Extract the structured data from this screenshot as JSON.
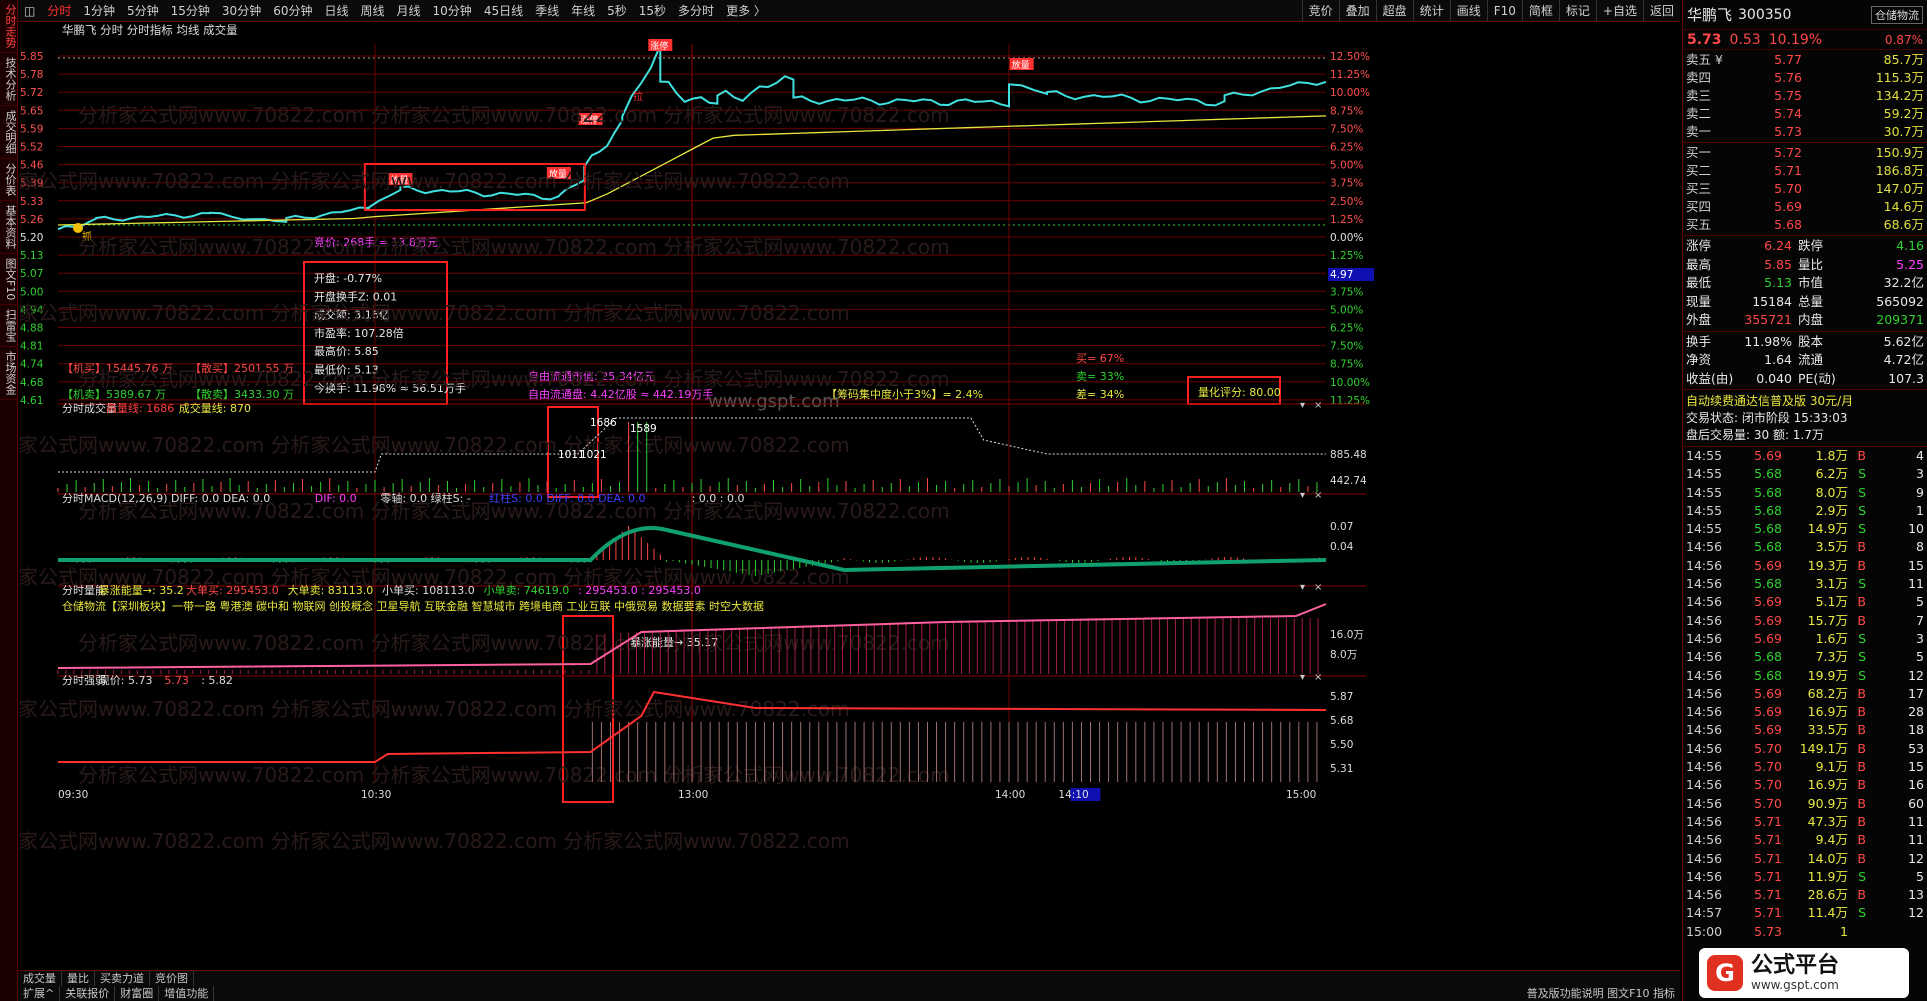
{
  "left_tabs": [
    "分时走势",
    "技术分析",
    "成交明细",
    "分价表",
    "基本资料",
    "图文F10",
    "扫雷宝",
    "市场资金"
  ],
  "top_tabs": [
    "分时",
    "1分钟",
    "5分钟",
    "15分钟",
    "30分钟",
    "60分钟",
    "日线",
    "周线",
    "月线",
    "10分钟",
    "45日线",
    "季线",
    "年线",
    "5秒",
    "15秒",
    "多分时",
    "更多 〉"
  ],
  "top_right": [
    "竞价",
    "叠加",
    "超盘",
    "统计",
    "画线",
    "F10",
    "简框",
    "标记",
    "+自选",
    "返回"
  ],
  "chart_title": {
    "stock": "华鹏飞",
    "items": [
      "分时",
      "分时指标",
      "均线",
      "成交量"
    ]
  },
  "price_axis": [
    "5.85",
    "5.78",
    "5.72",
    "5.65",
    "5.59",
    "5.52",
    "5.46",
    "5.39",
    "5.33",
    "5.26",
    "5.20",
    "5.13",
    "5.07",
    "5.00",
    "4.94",
    "4.88",
    "4.81",
    "4.74",
    "4.68",
    "4.61"
  ],
  "pct_axis": [
    "12.50%",
    "11.25%",
    "10.00%",
    "8.75%",
    "7.50%",
    "6.25%",
    "5.00%",
    "3.75%",
    "2.50%",
    "1.25%",
    "0.00%",
    "1.25%",
    "2.50%",
    "3.75%",
    "5.00%",
    "6.25%",
    "7.50%",
    "8.75%",
    "10.00%",
    "11.25%"
  ],
  "mark_497": "4.97",
  "badges": {
    "zhangting": "涨停",
    "huitiao": "拉",
    "zhuaqi": "抓",
    "fangliang": "放量"
  },
  "info_box": [
    "开盘: -0.77%",
    "开盘换手Z: 0.01",
    "成交额: 3.16亿",
    "市盈率: 107.28倍",
    "最高价: 5.85",
    "最低价: 5.13",
    "今换手: 11.98% ≈ 56.51万手"
  ],
  "auction_text": "竞价: 268手 = 13.8万元",
  "jimai1": "【机买】15445.76 万",
  "sanmai1": "【散买】2501.55 万",
  "jimai2": "【机卖】5389.67 万",
  "sanmai2": "【散卖】3433.30 万",
  "float_value": "自由流通市值: 25.34亿元",
  "float_shares": "自由流通盘: 4.42亿股 ≈ 442.19万手",
  "jizhongdu": "【筹码集中度小于3%】= 2.4%",
  "maibi": [
    "买= 67%",
    "卖= 33%",
    "差= 34%"
  ],
  "score": "量化评分: 80.00",
  "watermark": "分析家公式网www.70822.com",
  "center_watermark": "www.gspt.com",
  "vol_panel": {
    "title": "分时成交量",
    "l1": "高量线: 1686",
    "l2": "成交量线: 870",
    "axis": [
      "885.48",
      "442.74"
    ],
    "labels": [
      "1686",
      "1589",
      "1011",
      "1021"
    ]
  },
  "macd_panel": {
    "title": "分时MACD(12,26,9) DIFF: 0.0 DEA: 0.0",
    "extra": "DIF: 0.0",
    "extra2": "零轴: 0.0 绿柱S: -",
    "extra3": "红柱S: 0.0 DIFF: 0.0 DEA: 0.0",
    "extra4": ": 0.0 : 0.0",
    "axis": [
      "0.07",
      "0.04"
    ]
  },
  "energy_panel": {
    "title": "分时量能",
    "l1": "暴涨能量→: 35.2",
    "l2": "大单买: 295453.0",
    "l3": "大单卖: 83113.0",
    "l4": "小单买: 108113.0",
    "l5": "小单卖: 74619.0",
    "l6": ": 295453.0 : 295453.0",
    "concepts": "仓储物流【深圳板块】一带一路 粤港澳 碳中和 物联网 创投概念 卫星导航 互联金融 智慧城市 跨境电商 工业互联 中俄贸易 数据要素 时空大数据",
    "arrow_label": "暴涨能量→ 35.17",
    "axis": [
      "16.0万",
      "8.0万"
    ]
  },
  "strength_panel": {
    "title": "分时强弱",
    "l1": "现价: 5.73",
    "l2": "5.73",
    "l3": ": 5.82",
    "axis": [
      "5.87",
      "5.68",
      "5.50",
      "5.31"
    ]
  },
  "time_axis": [
    "09:30",
    "10:30",
    "13:00",
    "14:00",
    "14:10",
    "15:00"
  ],
  "bottom_tabs1": [
    "成交量",
    "量比",
    "买卖力道",
    "竞价图"
  ],
  "bottom_tabs2": [
    "扩展^",
    "关联报价",
    "财富圈",
    "增值功能"
  ],
  "bottom_right": [
    "普及版功能说明",
    "图文F10",
    "指标"
  ],
  "right": {
    "name": "华鹏飞",
    "code": "300350",
    "btn": "仓储物流",
    "price": "5.73",
    "chg": "0.53",
    "pct": "10.19%",
    "sector_pct": "0.87%",
    "asks": [
      [
        "卖五 ¥",
        "5.77",
        "85.7万"
      ],
      [
        "卖四",
        "5.76",
        "115.3万"
      ],
      [
        "卖三",
        "5.75",
        "134.2万"
      ],
      [
        "卖二",
        "5.74",
        "59.2万"
      ],
      [
        "卖一",
        "5.73",
        "30.7万"
      ]
    ],
    "bids": [
      [
        "买一",
        "5.72",
        "150.9万"
      ],
      [
        "买二",
        "5.71",
        "186.8万"
      ],
      [
        "买三",
        "5.70",
        "147.0万"
      ],
      [
        "买四",
        "5.69",
        "14.6万"
      ],
      [
        "买五",
        "5.68",
        "68.6万"
      ]
    ],
    "stats": [
      [
        "涨停",
        "6.24",
        "跌停",
        "4.16"
      ],
      [
        "最高",
        "5.85",
        "量比",
        "5.25"
      ],
      [
        "最低",
        "5.13",
        "市值",
        "32.2亿"
      ],
      [
        "现量",
        "15184",
        "总量",
        "565092"
      ],
      [
        "外盘",
        "355721",
        "内盘",
        "209371"
      ]
    ],
    "stats2": [
      [
        "换手",
        "11.98%",
        "股本",
        "5.62亿"
      ],
      [
        "净资",
        "1.64",
        "流通",
        "4.72亿"
      ],
      [
        "收益(由)",
        "0.040",
        "PE(动)",
        "107.3"
      ]
    ],
    "promo": "自动续费通达信普及版 30元/月",
    "trade_state": "交易状态: 闭市阶段 15:33:03",
    "trade_days": "盘后交易量: 30  额: 1.7万",
    "ticks": [
      [
        "14:55",
        "5.69",
        "1.8万",
        "B",
        "4"
      ],
      [
        "14:55",
        "5.68",
        "6.2万",
        "S",
        "3"
      ],
      [
        "14:55",
        "5.68",
        "8.0万",
        "S",
        "9"
      ],
      [
        "14:55",
        "5.68",
        "2.9万",
        "S",
        "1"
      ],
      [
        "14:55",
        "5.68",
        "14.9万",
        "S",
        "10"
      ],
      [
        "14:56",
        "5.68",
        "3.5万",
        "B",
        "8"
      ],
      [
        "14:56",
        "5.69",
        "19.3万",
        "B",
        "15"
      ],
      [
        "14:56",
        "5.68",
        "3.1万",
        "S",
        "11"
      ],
      [
        "14:56",
        "5.69",
        "5.1万",
        "B",
        "5"
      ],
      [
        "14:56",
        "5.69",
        "15.7万",
        "B",
        "7"
      ],
      [
        "14:56",
        "5.69",
        "1.6万",
        "S",
        "3"
      ],
      [
        "14:56",
        "5.68",
        "7.3万",
        "S",
        "5"
      ],
      [
        "14:56",
        "5.68",
        "19.9万",
        "S",
        "12"
      ],
      [
        "14:56",
        "5.69",
        "68.2万",
        "B",
        "17"
      ],
      [
        "14:56",
        "5.69",
        "16.9万",
        "B",
        "28"
      ],
      [
        "14:56",
        "5.69",
        "33.5万",
        "B",
        "18"
      ],
      [
        "14:56",
        "5.70",
        "149.1万",
        "B",
        "53"
      ],
      [
        "14:56",
        "5.70",
        "9.1万",
        "B",
        "15"
      ],
      [
        "14:56",
        "5.70",
        "16.9万",
        "B",
        "16"
      ],
      [
        "14:56",
        "5.70",
        "90.9万",
        "B",
        "60"
      ],
      [
        "14:56",
        "5.71",
        "47.3万",
        "B",
        "11"
      ],
      [
        "14:56",
        "5.71",
        "9.4万",
        "B",
        "11"
      ],
      [
        "14:56",
        "5.71",
        "14.0万",
        "B",
        "12"
      ],
      [
        "14:56",
        "5.71",
        "11.9万",
        "S",
        "5"
      ],
      [
        "14:56",
        "5.71",
        "28.6万",
        "B",
        "13"
      ],
      [
        "14:57",
        "5.71",
        "11.4万",
        "S",
        "12"
      ],
      [
        "15:00",
        "5.73",
        "1",
        "",
        ""
      ]
    ]
  },
  "logo_text": "公式平台",
  "logo_url": "www.gspt.com",
  "colors": {
    "price_line": "#40e0e0",
    "avg_line": "#e8e840",
    "grid": "#6a0000",
    "up": "#ff4848",
    "down": "#30d030",
    "box": "#ff2020"
  }
}
